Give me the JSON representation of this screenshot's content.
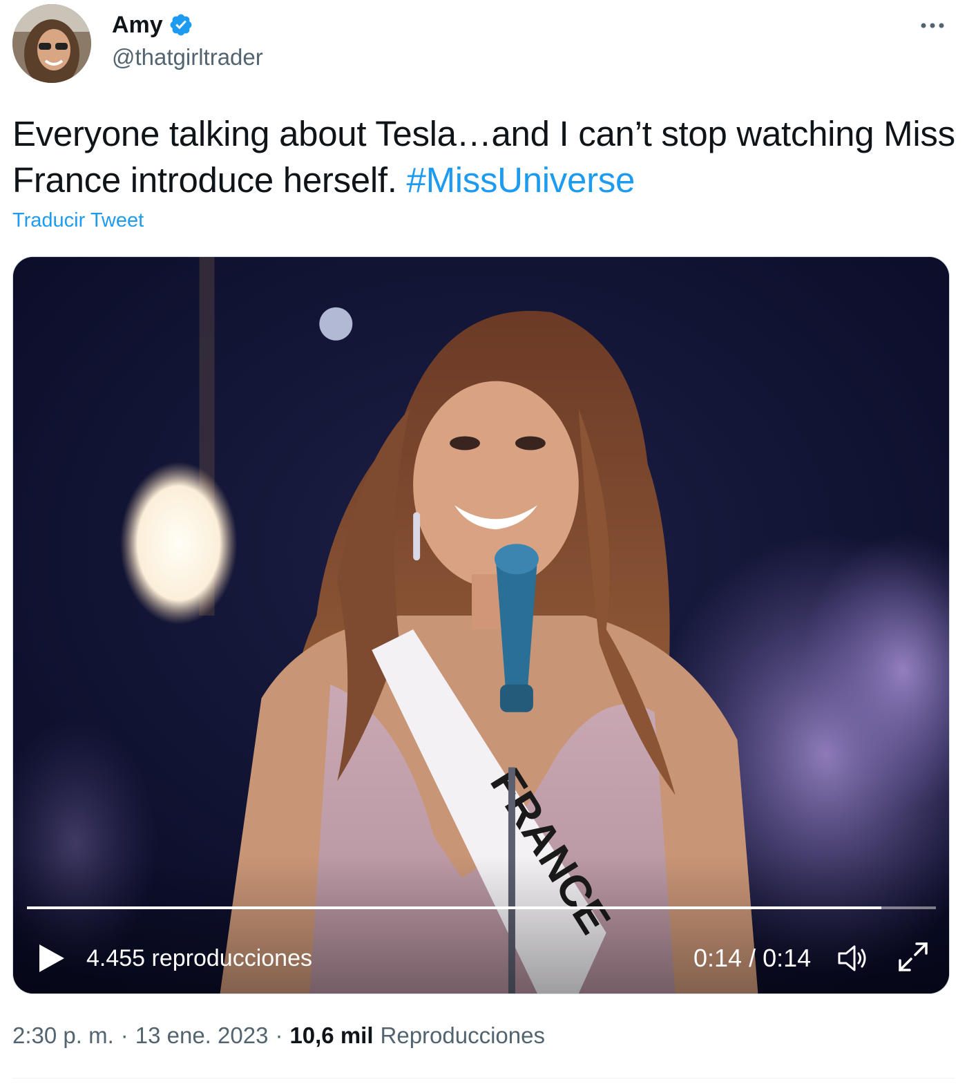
{
  "author": {
    "display_name": "Amy",
    "handle": "@thatgirltrader",
    "verified": true,
    "verified_color": "#1d9bf0"
  },
  "tweet": {
    "text_before_hashtag": "Everyone talking about Tesla…and I can’t stop watching Miss France introduce herself.",
    "hashtag": "#MissUniverse",
    "translate_label": "Traducir Tweet"
  },
  "video": {
    "views_label": "4.455 reproducciones",
    "time_label": "0:14 / 0:14",
    "progress": 0.94,
    "sash_text": "FRANCE"
  },
  "meta": {
    "time": "2:30 p. m.",
    "separator": "·",
    "date": "13 ene. 2023",
    "views_count": "10,6 mil",
    "views_word": "Reproducciones"
  },
  "colors": {
    "link": "#1d9bf0",
    "text": "#0f1419",
    "secondary": "#536471"
  }
}
